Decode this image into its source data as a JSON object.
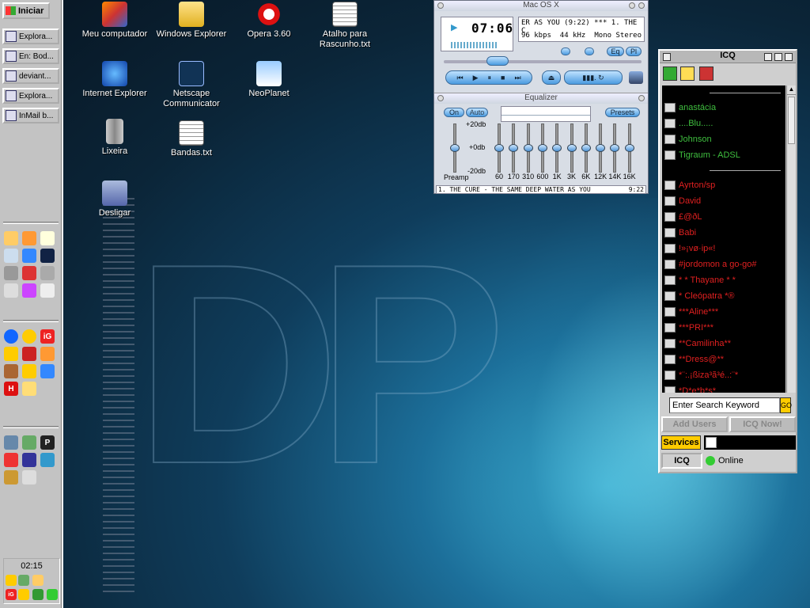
{
  "taskbar": {
    "start_label": "Iniciar",
    "tasks": [
      {
        "label": "Explora...",
        "icon": "folder-icon"
      },
      {
        "label": "En: Bod...",
        "icon": "mail-icon"
      },
      {
        "label": "deviant...",
        "icon": "browser-icon"
      },
      {
        "label": "Explora...",
        "icon": "folder-icon"
      },
      {
        "label": "InMail b...",
        "icon": "mail-icon"
      }
    ],
    "clock": "02:15"
  },
  "desktop_icons": [
    {
      "label": "Meu computador",
      "icon": "computer-icon"
    },
    {
      "label": "Windows Explorer",
      "icon": "explorer-icon"
    },
    {
      "label": "Opera 3.60",
      "icon": "opera-icon"
    },
    {
      "label": "Atalho para Rascunho.txt",
      "icon": "text-file-icon"
    },
    {
      "label": "Internet Explorer",
      "icon": "ie-icon"
    },
    {
      "label": "Netscape Communicator",
      "icon": "netscape-icon"
    },
    {
      "label": "NeoPlanet",
      "icon": "neoplanet-icon"
    },
    {
      "label": "Lixeira",
      "icon": "recycle-bin-icon"
    },
    {
      "label": "Bandas.txt",
      "icon": "text-file-icon"
    },
    {
      "label": "Desligar",
      "icon": "shutdown-icon"
    }
  ],
  "winamp": {
    "title": "Mac OS X",
    "time": "07:06",
    "ticker": "ER AS YOU (9:22) *** 1. THE C",
    "kbps": "96 kbps",
    "khz": "44 kHz",
    "mono": "Mono",
    "stereo": "Stereo",
    "eq_btn": "Eq",
    "pl_btn": "Pl",
    "eq_title": "Equalizer",
    "on": "On",
    "auto": "Auto",
    "presets": "Presets",
    "db_top": "+20db",
    "db_mid": "+0db",
    "db_bot": "-20db",
    "preamp": "Preamp",
    "bands": [
      "60",
      "170",
      "310",
      "600",
      "1K",
      "3K",
      "6K",
      "12K",
      "14K",
      "16K"
    ],
    "playlist_item": "1. THE CURE - THE SAME DEEP WATER AS YOU",
    "playlist_time": "9:22"
  },
  "icq": {
    "title": "ICQ",
    "buddies_online": [
      {
        "name": "anastácia",
        "color": "#3fbf3f",
        "icon": "mobile-icon"
      },
      {
        "name": "....Blu.....",
        "color": "#3fbf3f",
        "icon": "icq-flower-icon"
      },
      {
        "name": "Johnson",
        "color": "#3fbf3f",
        "icon": "icq-flower-icon"
      },
      {
        "name": "Tigraum - ADSL",
        "color": "#3fbf3f",
        "icon": "away-icon"
      }
    ],
    "buddies_offline": [
      {
        "name": "Ayrton/sp",
        "color": "#e02020",
        "icon": "clock-icon"
      },
      {
        "name": "David",
        "color": "#e02020",
        "icon": "icq-flower-icon"
      },
      {
        "name": "£@ðL",
        "color": "#e02020",
        "icon": "mobile-icon"
      },
      {
        "name": "Babi",
        "color": "#e02020",
        "icon": "icq-flower-icon"
      },
      {
        "name": "!»¡vø·ip«!",
        "color": "#e02020",
        "icon": "icq-flower-icon"
      },
      {
        "name": "#jordomon a go-go#",
        "color": "#e02020",
        "icon": "icq-flower-icon"
      },
      {
        "name": "* * Thayane * *",
        "color": "#e02020",
        "icon": "icq-flower-icon"
      },
      {
        "name": "* Cleópatra *®",
        "color": "#e02020",
        "icon": "icq-flower-icon"
      },
      {
        "name": "***Aline***",
        "color": "#e02020",
        "icon": "icq-flower-icon"
      },
      {
        "name": "***PRI***",
        "color": "#e02020",
        "icon": "icq-flower-icon"
      },
      {
        "name": "**Camilinha**",
        "color": "#e02020",
        "icon": "icq-flower-icon"
      },
      {
        "name": "**Dress@**",
        "color": "#e02020",
        "icon": "icq-flower-icon"
      },
      {
        "name": "*¨:.¡ßiza³ã³é..:¨*",
        "color": "#e02020",
        "icon": "icq-flower-icon"
      },
      {
        "name": "*D*e*b*s*",
        "color": "#e02020",
        "icon": "icq-flower-icon"
      }
    ],
    "search_placeholder": "Enter Search Keyword",
    "go": "GO",
    "add_users": "Add Users",
    "icq_now": "ICQ Now!",
    "services": "Services",
    "tab_icq": "ICQ",
    "status": "Online"
  }
}
